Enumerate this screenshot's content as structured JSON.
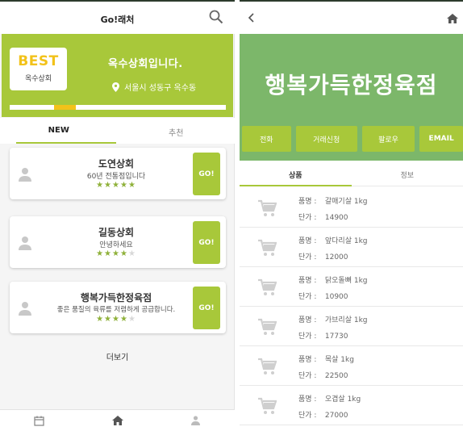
{
  "colors": {
    "accent": "#a8c83a",
    "store_banner": "#7cb76a",
    "star_active": "#8fb13a",
    "highlight": "#f2c21a"
  },
  "left": {
    "app_title": "Go!래처",
    "search_icon": "search-icon",
    "best": {
      "badge": "BEST",
      "store": "옥수상회",
      "name": "옥수상회입니다.",
      "location": "서울시 성동구 옥수동"
    },
    "banner_progress": 0.1,
    "tabs": [
      {
        "label": "NEW"
      },
      {
        "label": "추천"
      }
    ],
    "stores": [
      {
        "name": "도연상회",
        "desc": "60년 전통점입니다",
        "rating": 5,
        "go": "GO!"
      },
      {
        "name": "길동상회",
        "desc": "안녕하세요",
        "rating": 4,
        "go": "GO!"
      },
      {
        "name": "행복가득한정육점",
        "desc": "좋은 품질의 육류를 저렴하게 공급합니다.",
        "rating": 3.5,
        "go": "GO!"
      }
    ],
    "more": "더보기",
    "bottom_nav": [
      "calendar-icon",
      "home-icon",
      "person-icon"
    ]
  },
  "right": {
    "back_icon": "back-icon",
    "home_icon": "home-icon",
    "store_name": "행복가득한정육점",
    "actions": [
      {
        "label": "전화"
      },
      {
        "label": "거래신청"
      },
      {
        "label": "팔로우"
      },
      {
        "label": "EMAIL"
      }
    ],
    "tabs": [
      {
        "label": "상품"
      },
      {
        "label": "정보"
      }
    ],
    "product_label": "품명 :",
    "price_label": "단가 :",
    "products": [
      {
        "name": "갈매기살 1kg",
        "price": "14900"
      },
      {
        "name": "앞다리살 1kg",
        "price": "12000"
      },
      {
        "name": "닭오돌뼈 1kg",
        "price": "10900"
      },
      {
        "name": "가브리살 1kg",
        "price": "17730"
      },
      {
        "name": "목살 1kg",
        "price": "22500"
      },
      {
        "name": "오겹살 1kg",
        "price": "27000"
      }
    ]
  }
}
